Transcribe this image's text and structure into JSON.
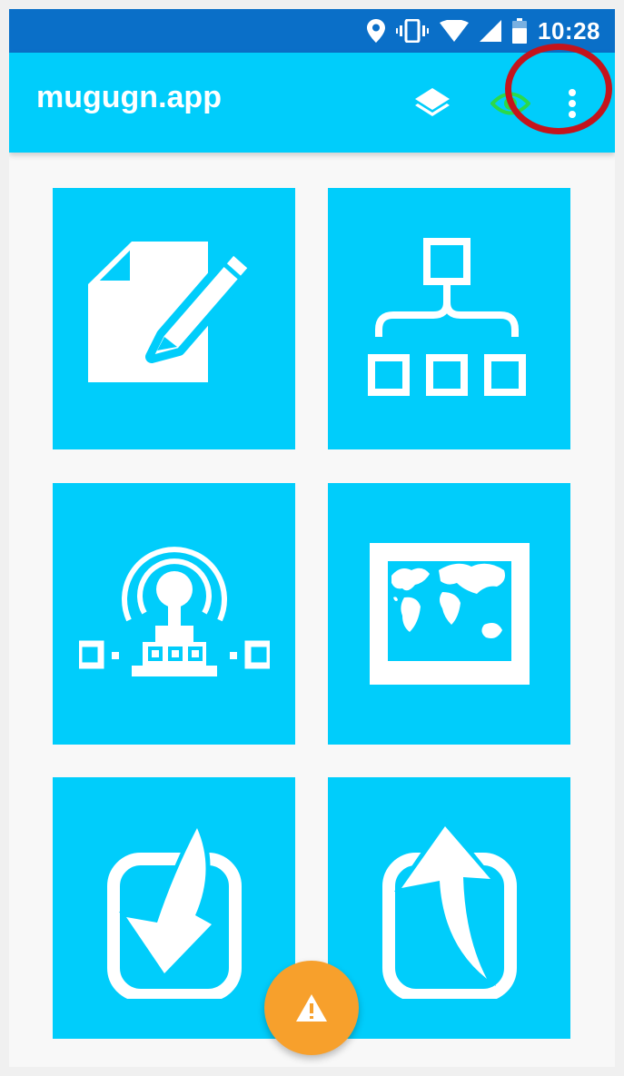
{
  "status_bar": {
    "time": "10:28",
    "icons": [
      "location-icon",
      "vibrate-icon",
      "wifi-icon",
      "signal-icon",
      "battery-icon"
    ]
  },
  "app_bar": {
    "title": "mugugn.app",
    "actions": [
      "layers-icon",
      "eye-icon",
      "more-vert-icon"
    ]
  },
  "tiles": [
    {
      "icon": "edit-document-icon"
    },
    {
      "icon": "hierarchy-icon"
    },
    {
      "icon": "broadcast-antenna-icon"
    },
    {
      "icon": "world-map-icon"
    },
    {
      "icon": "download-arrow-icon"
    },
    {
      "icon": "upload-arrow-icon"
    }
  ],
  "fab": {
    "icon": "warning-icon"
  },
  "colors": {
    "status_bar": "#0a6fc8",
    "app_bar": "#00cdfb",
    "tile": "#00cdfb",
    "fab": "#f7a02c",
    "annotation": "#c4141c",
    "eye_icon": "#2bd94a"
  }
}
